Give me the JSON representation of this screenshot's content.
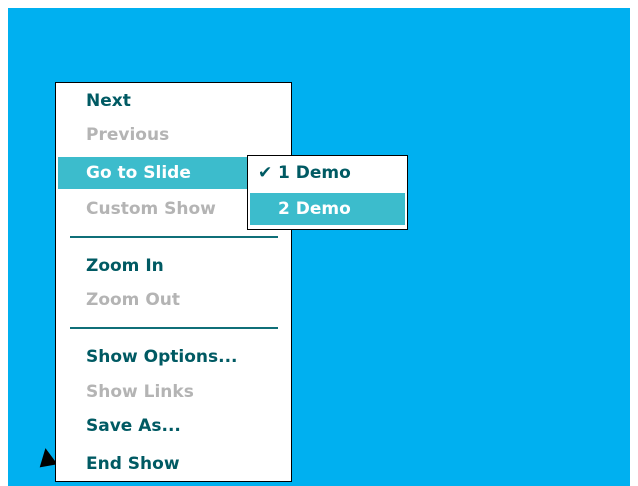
{
  "colors": {
    "background": "#00b0f0",
    "menu_text": "#005a63",
    "disabled_text": "#b4b4b4",
    "highlight": "#3cbccc"
  },
  "menu": {
    "items": [
      {
        "label": "Next",
        "enabled": true
      },
      {
        "label": "Previous",
        "enabled": false
      },
      {
        "label": "Go to Slide",
        "enabled": true,
        "selected": true,
        "has_submenu": true
      },
      {
        "label": "Custom Show",
        "enabled": false
      },
      {
        "label": "Zoom In",
        "enabled": true
      },
      {
        "label": "Zoom Out",
        "enabled": false
      },
      {
        "label": "Show Options...",
        "enabled": true
      },
      {
        "label": "Show Links",
        "enabled": false
      },
      {
        "label": "Save As...",
        "enabled": true
      },
      {
        "label": "End Show",
        "enabled": true
      }
    ]
  },
  "submenu": {
    "items": [
      {
        "label": "1 Demo",
        "checked": true,
        "check_glyph": "✔"
      },
      {
        "label": "2 Demo",
        "checked": false,
        "selected": true
      }
    ]
  },
  "icons": {
    "cursor": "arrow-cursor-icon",
    "check": "checkmark-icon"
  }
}
